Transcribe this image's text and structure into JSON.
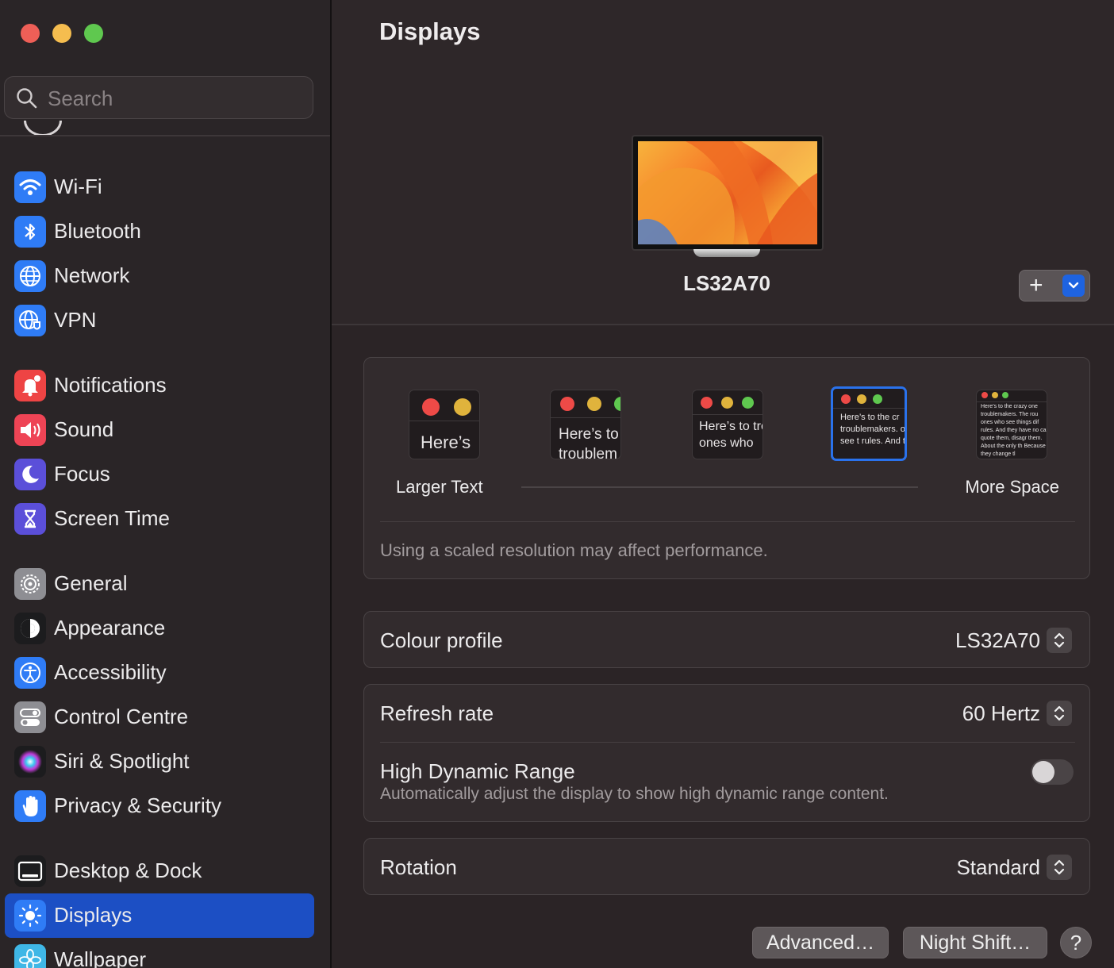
{
  "window": {
    "title": "Displays"
  },
  "search": {
    "placeholder": "Search"
  },
  "sidebar": {
    "items": [
      {
        "label": "Wi-Fi",
        "icon": "wifi-icon",
        "color": "#2f7cf6"
      },
      {
        "label": "Bluetooth",
        "icon": "bluetooth-icon",
        "color": "#2f7cf6"
      },
      {
        "label": "Network",
        "icon": "globe-icon",
        "color": "#2f7cf6"
      },
      {
        "label": "VPN",
        "icon": "vpn-globe-icon",
        "color": "#2f7cf6"
      },
      {
        "label": "Notifications",
        "icon": "bell-icon",
        "color": "#ee4444"
      },
      {
        "label": "Sound",
        "icon": "speaker-icon",
        "color": "#ee4455"
      },
      {
        "label": "Focus",
        "icon": "moon-icon",
        "color": "#5b4fd9"
      },
      {
        "label": "Screen Time",
        "icon": "hourglass-icon",
        "color": "#5b4fd9"
      },
      {
        "label": "General",
        "icon": "gear-icon",
        "color": "#8e8e93"
      },
      {
        "label": "Appearance",
        "icon": "appearance-icon",
        "color": "#1c1c1e"
      },
      {
        "label": "Accessibility",
        "icon": "accessibility-icon",
        "color": "#2f7cf6"
      },
      {
        "label": "Control Centre",
        "icon": "switches-icon",
        "color": "#8e8e93"
      },
      {
        "label": "Siri & Spotlight",
        "icon": "siri-icon",
        "color": "#1c1c1e"
      },
      {
        "label": "Privacy & Security",
        "icon": "hand-icon",
        "color": "#2f7cf6"
      },
      {
        "label": "Desktop & Dock",
        "icon": "dock-icon",
        "color": "#1c1c1e"
      },
      {
        "label": "Displays",
        "icon": "sun-icon",
        "color": "#2f7cf6",
        "selected": true
      },
      {
        "label": "Wallpaper",
        "icon": "flower-icon",
        "color": "#3fb7e6"
      }
    ]
  },
  "display": {
    "name": "LS32A70",
    "add_button_symbol": "+"
  },
  "resolution": {
    "options": [
      {
        "preview_text": "Here’s"
      },
      {
        "preview_text": "Here’s to troublem"
      },
      {
        "preview_text": "Here’s to troublema ones who"
      },
      {
        "preview_text": "Here’s to the cr troublemakers. ones who see t rules. And they",
        "selected": true
      },
      {
        "preview_text": "Here’s to the crazy one troublemakers. The rou ones who see things dif rules. And they have no can quote them, disagr them. About the only th Because they change tl"
      }
    ],
    "left_label": "Larger Text",
    "right_label": "More Space",
    "note": "Using a scaled resolution may affect performance."
  },
  "colour_profile": {
    "label": "Colour profile",
    "value": "LS32A70"
  },
  "refresh_rate": {
    "label": "Refresh rate",
    "value": "60 Hertz"
  },
  "hdr": {
    "label": "High Dynamic Range",
    "description": "Automatically adjust the display to show high dynamic range content.",
    "enabled": false
  },
  "rotation": {
    "label": "Rotation",
    "value": "Standard"
  },
  "footer": {
    "advanced_label": "Advanced…",
    "night_shift_label": "Night Shift…",
    "help_label": "?"
  },
  "colors": {
    "accent": "#1c4fc4",
    "background": "#2b2426"
  }
}
